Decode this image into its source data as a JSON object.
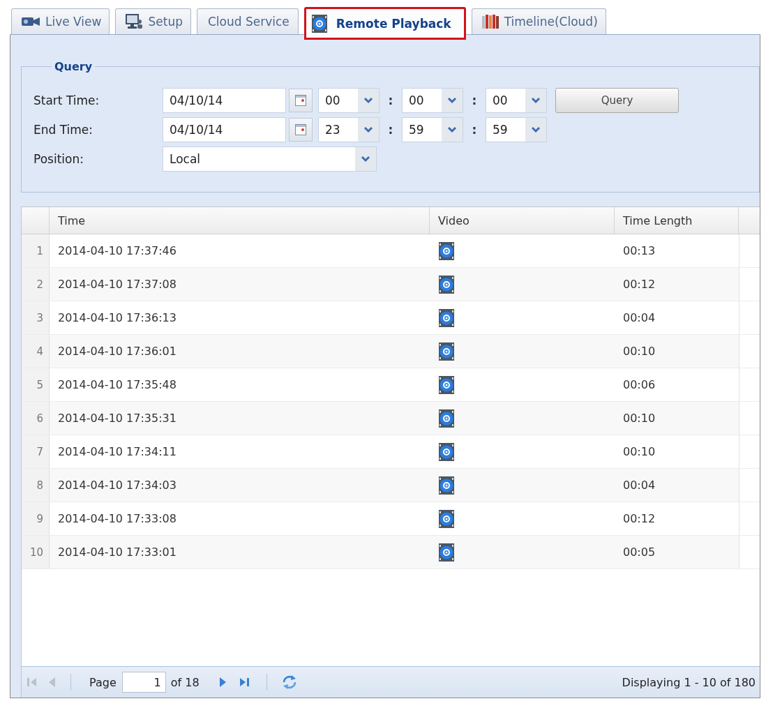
{
  "tabs": [
    {
      "label": "Live View",
      "selected": false
    },
    {
      "label": "Setup",
      "selected": false
    },
    {
      "label": "Cloud Service",
      "selected": false
    },
    {
      "label": "Remote Playback",
      "selected": true
    },
    {
      "label": "Timeline(Cloud)",
      "selected": false
    }
  ],
  "query": {
    "legend": "Query",
    "rows": [
      {
        "kind": "time",
        "label": "Start Time:",
        "date": "04/10/14",
        "hour": "00",
        "sep_1": ":",
        "minute": "00",
        "sep_2": ":",
        "second": "00",
        "button": "Query"
      },
      {
        "kind": "time",
        "label": "End Time:",
        "date": "04/10/14",
        "hour": "23",
        "sep_1": ":",
        "minute": "59",
        "sep_2": ":",
        "second": "59"
      },
      {
        "kind": "select",
        "label": "Position:",
        "value": "Local"
      }
    ]
  },
  "table": {
    "columns": [
      "Time",
      "Video",
      "Time Length"
    ],
    "rows": [
      {
        "number": "1",
        "time": "2014-04-10 17:37:46",
        "length": "00:13"
      },
      {
        "number": "2",
        "time": "2014-04-10 17:37:08",
        "length": "00:12"
      },
      {
        "number": "3",
        "time": "2014-04-10 17:36:13",
        "length": "00:04"
      },
      {
        "number": "4",
        "time": "2014-04-10 17:36:01",
        "length": "00:10"
      },
      {
        "number": "5",
        "time": "2014-04-10 17:35:48",
        "length": "00:06"
      },
      {
        "number": "6",
        "time": "2014-04-10 17:35:31",
        "length": "00:10"
      },
      {
        "number": "7",
        "time": "2014-04-10 17:34:11",
        "length": "00:10"
      },
      {
        "number": "8",
        "time": "2014-04-10 17:34:03",
        "length": "00:04"
      },
      {
        "number": "9",
        "time": "2014-04-10 17:33:08",
        "length": "00:12"
      },
      {
        "number": "10",
        "time": "2014-04-10 17:33:01",
        "length": "00:05"
      }
    ]
  },
  "pager": {
    "first": {
      "disabled": true
    },
    "prev": {
      "disabled": true
    },
    "page_label": "Page",
    "page": "1",
    "page_count": "of 18",
    "next": {
      "disabled": false
    },
    "last": {
      "disabled": false
    },
    "status": "Displaying 1 - 10 of 180"
  }
}
